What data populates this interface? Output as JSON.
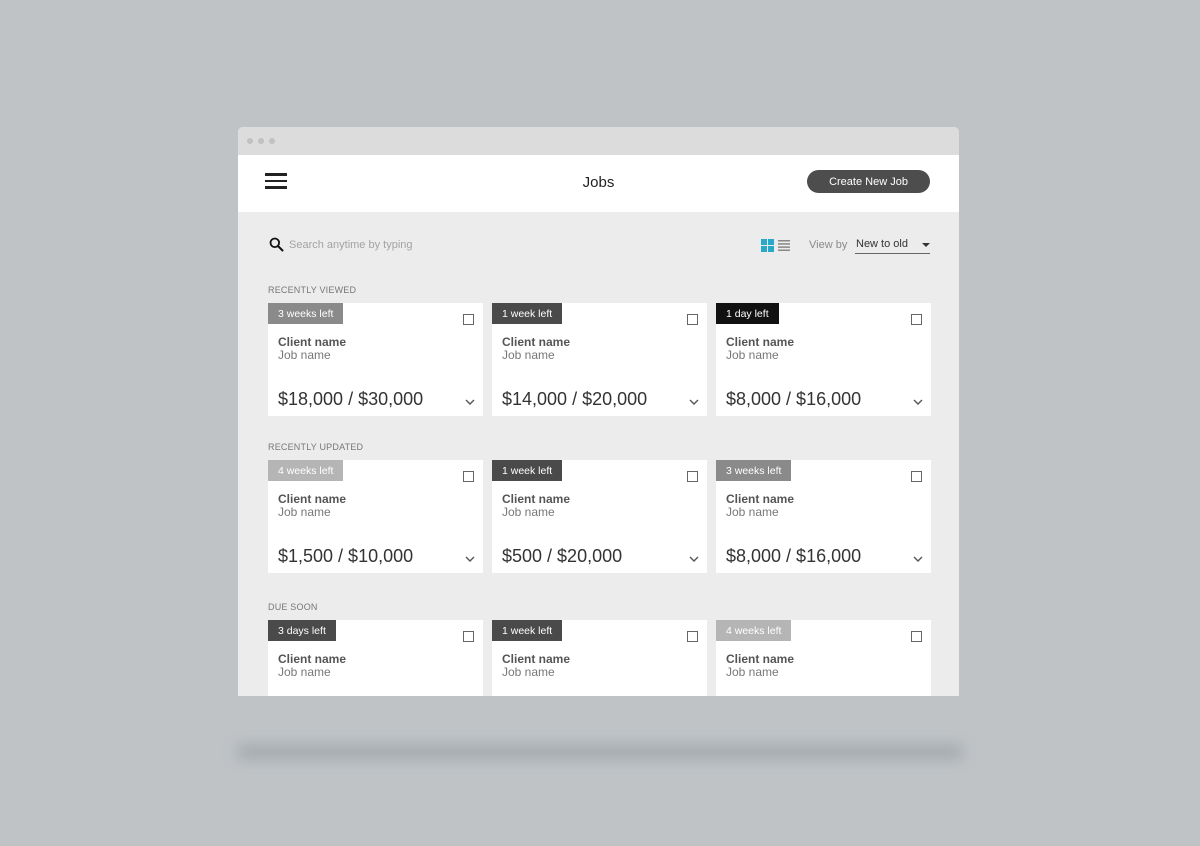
{
  "header": {
    "title": "Jobs",
    "create_label": "Create New Job"
  },
  "search": {
    "placeholder": "Search anytime by typing"
  },
  "view": {
    "label": "View by",
    "selected": "New to old",
    "active_icon": "grid-view-icon",
    "accent_color": "#2aa8c7"
  },
  "sections": [
    {
      "label": "RECENTLY VIEWED",
      "cards": [
        {
          "badge": "3 weeks left",
          "client": "Client name",
          "job": "Job name",
          "amount": "$18,000 / $30,000"
        },
        {
          "badge": "1 week left",
          "client": "Client name",
          "job": "Job name",
          "amount": "$14,000 / $20,000"
        },
        {
          "badge": "1 day left",
          "client": "Client name",
          "job": "Job name",
          "amount": "$8,000 / $16,000"
        }
      ]
    },
    {
      "label": "RECENTLY UPDATED",
      "cards": [
        {
          "badge": "4 weeks left",
          "client": "Client name",
          "job": "Job name",
          "amount": "$1,500 / $10,000"
        },
        {
          "badge": "1 week left",
          "client": "Client name",
          "job": "Job name",
          "amount": "$500 / $20,000"
        },
        {
          "badge": "3 weeks left",
          "client": "Client name",
          "job": "Job name",
          "amount": "$8,000 / $16,000"
        }
      ]
    },
    {
      "label": "DUE SOON",
      "cards": [
        {
          "badge": "3 days left",
          "client": "Client name",
          "job": "Job name",
          "amount": ""
        },
        {
          "badge": "1 week left",
          "client": "Client name",
          "job": "Job name",
          "amount": ""
        },
        {
          "badge": "4 weeks left",
          "client": "Client name",
          "job": "Job name",
          "amount": ""
        }
      ]
    }
  ],
  "badge_colors": {
    "3 weeks left": "#8a8a8a",
    "4 weeks left": "#b5b5b5",
    "1 week left": "#4a4a4a",
    "1 day left": "#111111",
    "3 days left": "#4a4a4a"
  }
}
